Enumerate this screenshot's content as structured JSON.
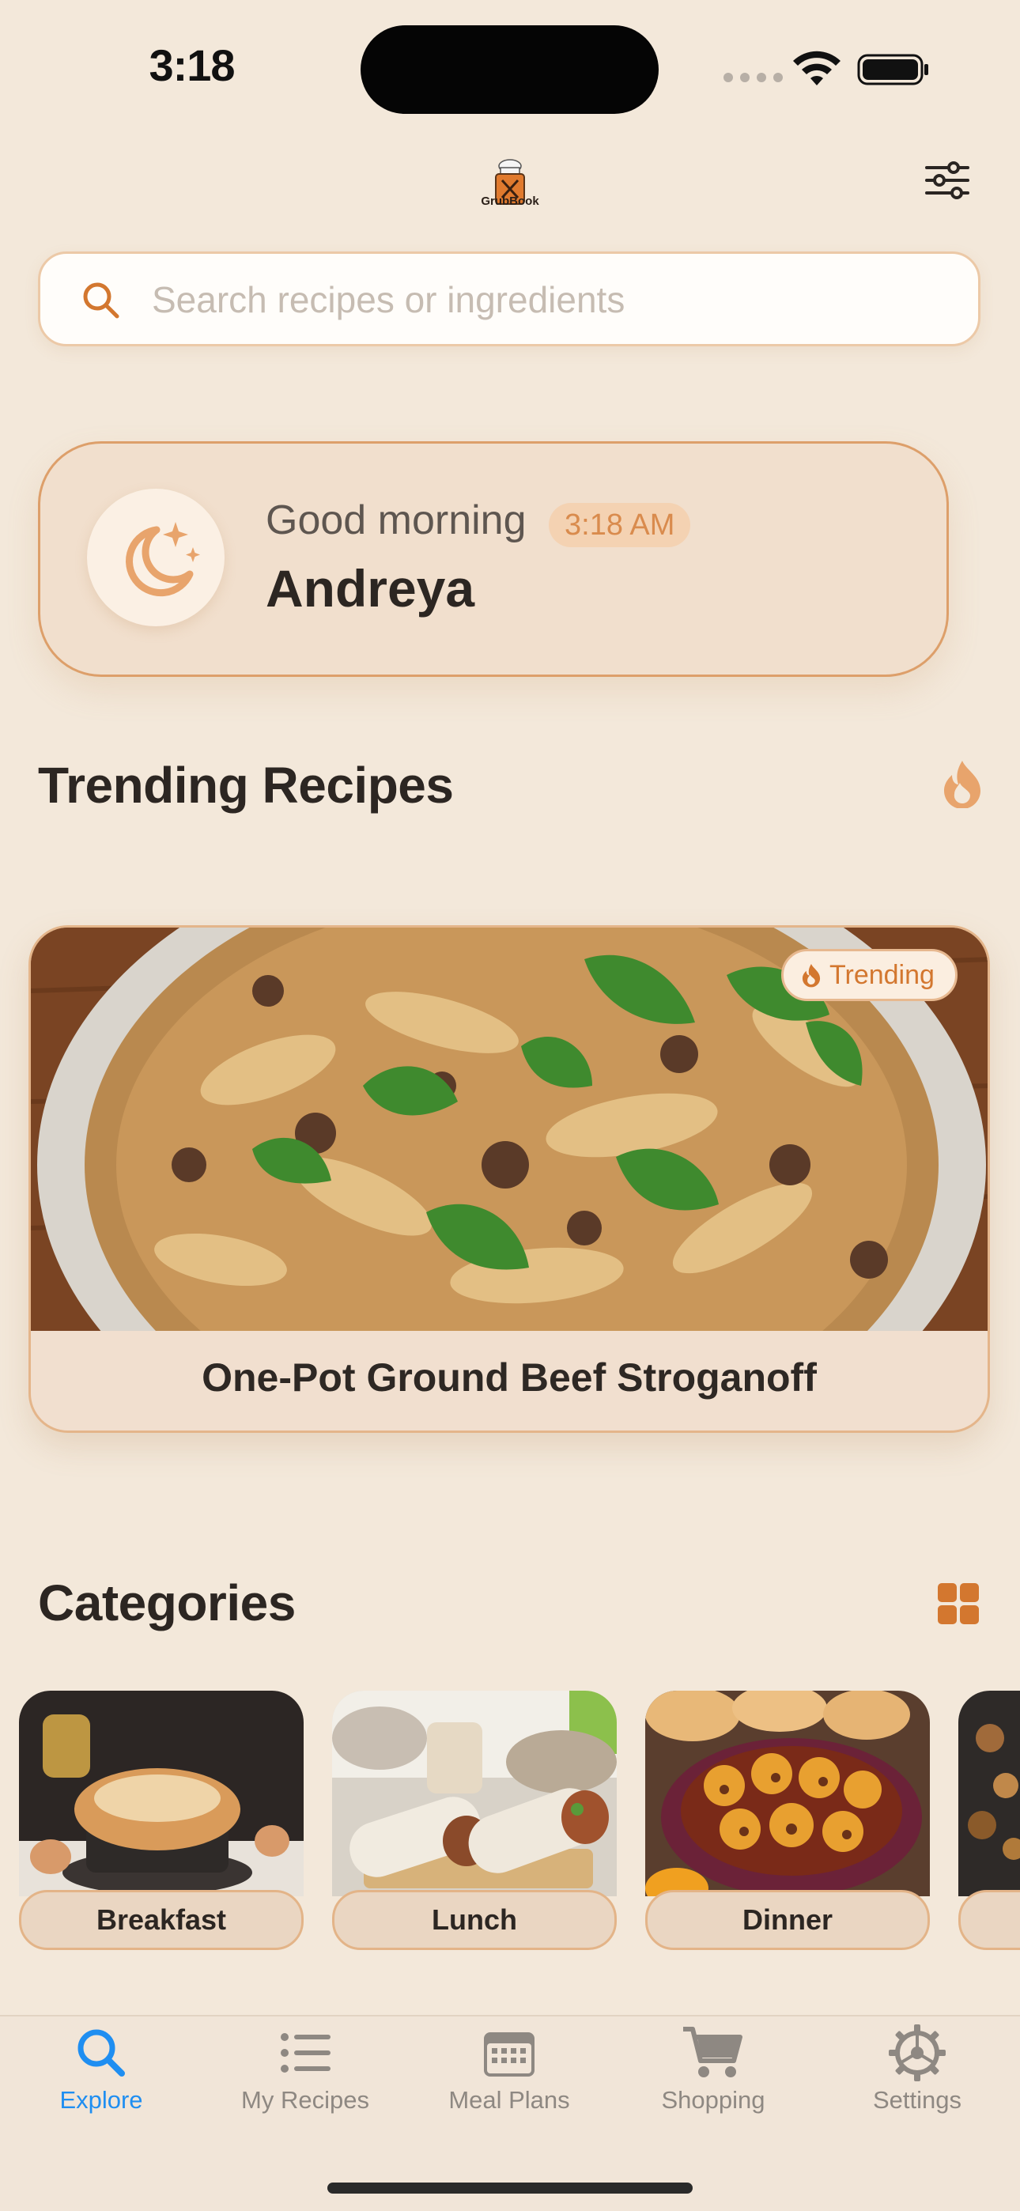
{
  "status_bar": {
    "time": "3:18"
  },
  "header": {
    "app_name": "GrubBook"
  },
  "search": {
    "placeholder": "Search recipes or ingredients"
  },
  "greeting": {
    "salutation": "Good morning",
    "time": "3:18 AM",
    "name": "Andreya"
  },
  "trending": {
    "title": "Trending Recipes",
    "badge": "Trending",
    "recipe": {
      "title": "One-Pot Ground Beef Stroganoff"
    }
  },
  "categories": {
    "title": "Categories",
    "items": [
      {
        "label": "Breakfast"
      },
      {
        "label": "Lunch"
      },
      {
        "label": "Dinner"
      }
    ]
  },
  "tabs": [
    {
      "label": "Explore",
      "icon": "search-icon",
      "active": true
    },
    {
      "label": "My Recipes",
      "icon": "list-icon",
      "active": false
    },
    {
      "label": "Meal Plans",
      "icon": "calendar-icon",
      "active": false
    },
    {
      "label": "Shopping",
      "icon": "cart-icon",
      "active": false
    },
    {
      "label": "Settings",
      "icon": "gear-icon",
      "active": false
    }
  ],
  "colors": {
    "background": "#f3e8da",
    "accent": "#d3772f",
    "active_tab": "#1f8ef1",
    "text": "#2c2622"
  }
}
